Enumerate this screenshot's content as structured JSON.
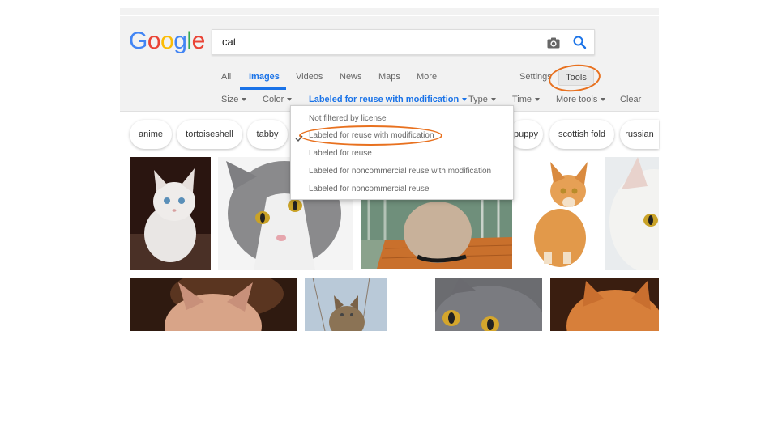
{
  "search": {
    "query": "cat"
  },
  "logo": {
    "letters": [
      {
        "ch": "G",
        "color": "#4285F4"
      },
      {
        "ch": "o",
        "color": "#EA4335"
      },
      {
        "ch": "o",
        "color": "#FBBC05"
      },
      {
        "ch": "g",
        "color": "#4285F4"
      },
      {
        "ch": "l",
        "color": "#34A853"
      },
      {
        "ch": "e",
        "color": "#EA4335"
      }
    ]
  },
  "nav": {
    "tabs": [
      "All",
      "Images",
      "Videos",
      "News",
      "Maps",
      "More"
    ],
    "active_tab": "Images",
    "settings": "Settings",
    "tools": "Tools"
  },
  "filters": {
    "size": "Size",
    "color": "Color",
    "usage_rights": "Labeled for reuse with modification",
    "type": "Type",
    "time": "Time",
    "more_tools": "More tools",
    "clear": "Clear"
  },
  "chips": [
    "anime",
    "tortoiseshell",
    "tabby",
    "puppy",
    "scottish fold",
    "russian"
  ],
  "usage_menu": {
    "options": [
      "Not filtered by license",
      "Labeled for reuse with modification",
      "Labeled for reuse",
      "Labeled for noncommercial reuse with modification",
      "Labeled for noncommercial reuse"
    ],
    "selected_index": 1
  },
  "colors": {
    "accent": "#1a73e8",
    "annotation": "#e8711f",
    "header_bg": "#f2f2f2"
  }
}
